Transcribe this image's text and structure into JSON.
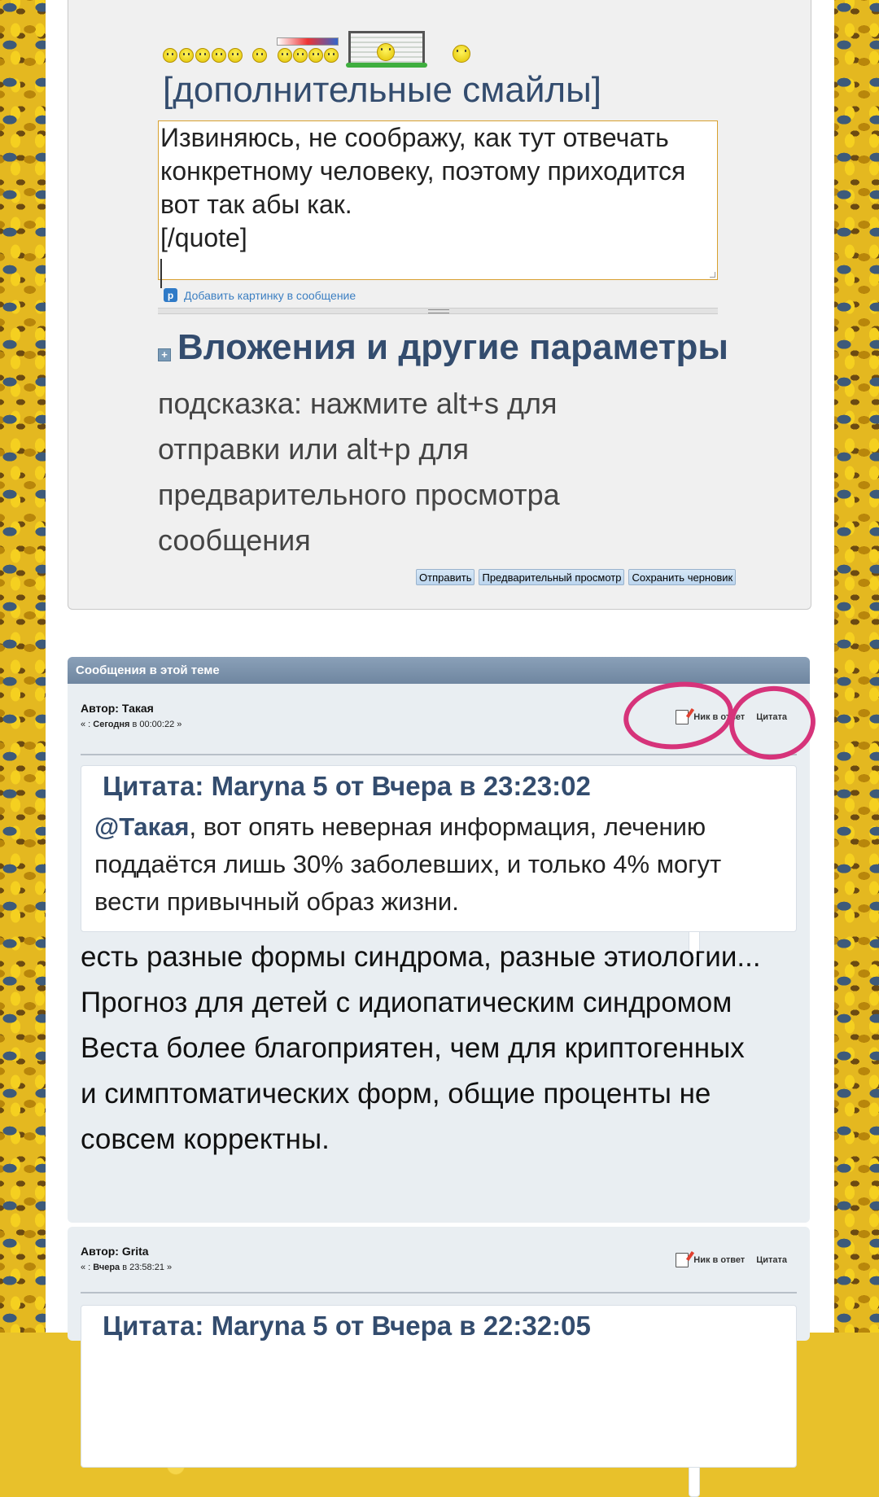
{
  "reply_form": {
    "more_smileys_link": "[дополнительные смайлы]",
    "message_text": "Извиняюсь, не соображу, как тут отвечать конкретному человеку, поэтому приходится вот так абы как.\n[/quote]\n",
    "add_image_link": "Добавить картинку в сообщение",
    "add_image_icon": "p-icon",
    "attachments_title": "Вложения и другие параметры",
    "hint": "подсказка: нажмите alt+s для отправки или alt+p для предварительного просмотра сообщения",
    "buttons": {
      "send": "Отправить",
      "preview": "Предварительный просмотр",
      "save_draft": "Сохранить черновик"
    }
  },
  "topic": {
    "header": "Сообщения в этой теме",
    "posts": [
      {
        "author_label": "Автор: Такая",
        "date_prefix": "« :",
        "date_day": "Сегодня",
        "date_rest": "в 00:00:22 »",
        "nick_reply": "Ник в ответ",
        "quote_action": "Цитата",
        "quote_header": "Цитата: Maryna 5 от Вчера в 23:23:02",
        "quote_mention": "@Такая",
        "quote_text": ", вот опять неверная информация, лечению поддаётся лишь 30% заболевших, и только 4% могут вести привычный образ жизни.",
        "body": "есть разные формы синдрома, разные этиологии... Прогноз для детей с идиопатическим синдромом Веста более благоприятен, чем для криптогенных и симптоматических форм, общие проценты не совсем корректны."
      },
      {
        "author_label": "Автор: Grita",
        "date_prefix": "« :",
        "date_day": "Вчера",
        "date_rest": "в 23:58:21 »",
        "nick_reply": "Ник в ответ",
        "quote_action": "Цитата",
        "quote_header": "Цитата: Maryna 5 от Вчера в 22:32:05"
      }
    ]
  },
  "colors": {
    "accent": "#334c6e",
    "highlight_circle": "#d6337a",
    "link": "#3c7fc2"
  }
}
